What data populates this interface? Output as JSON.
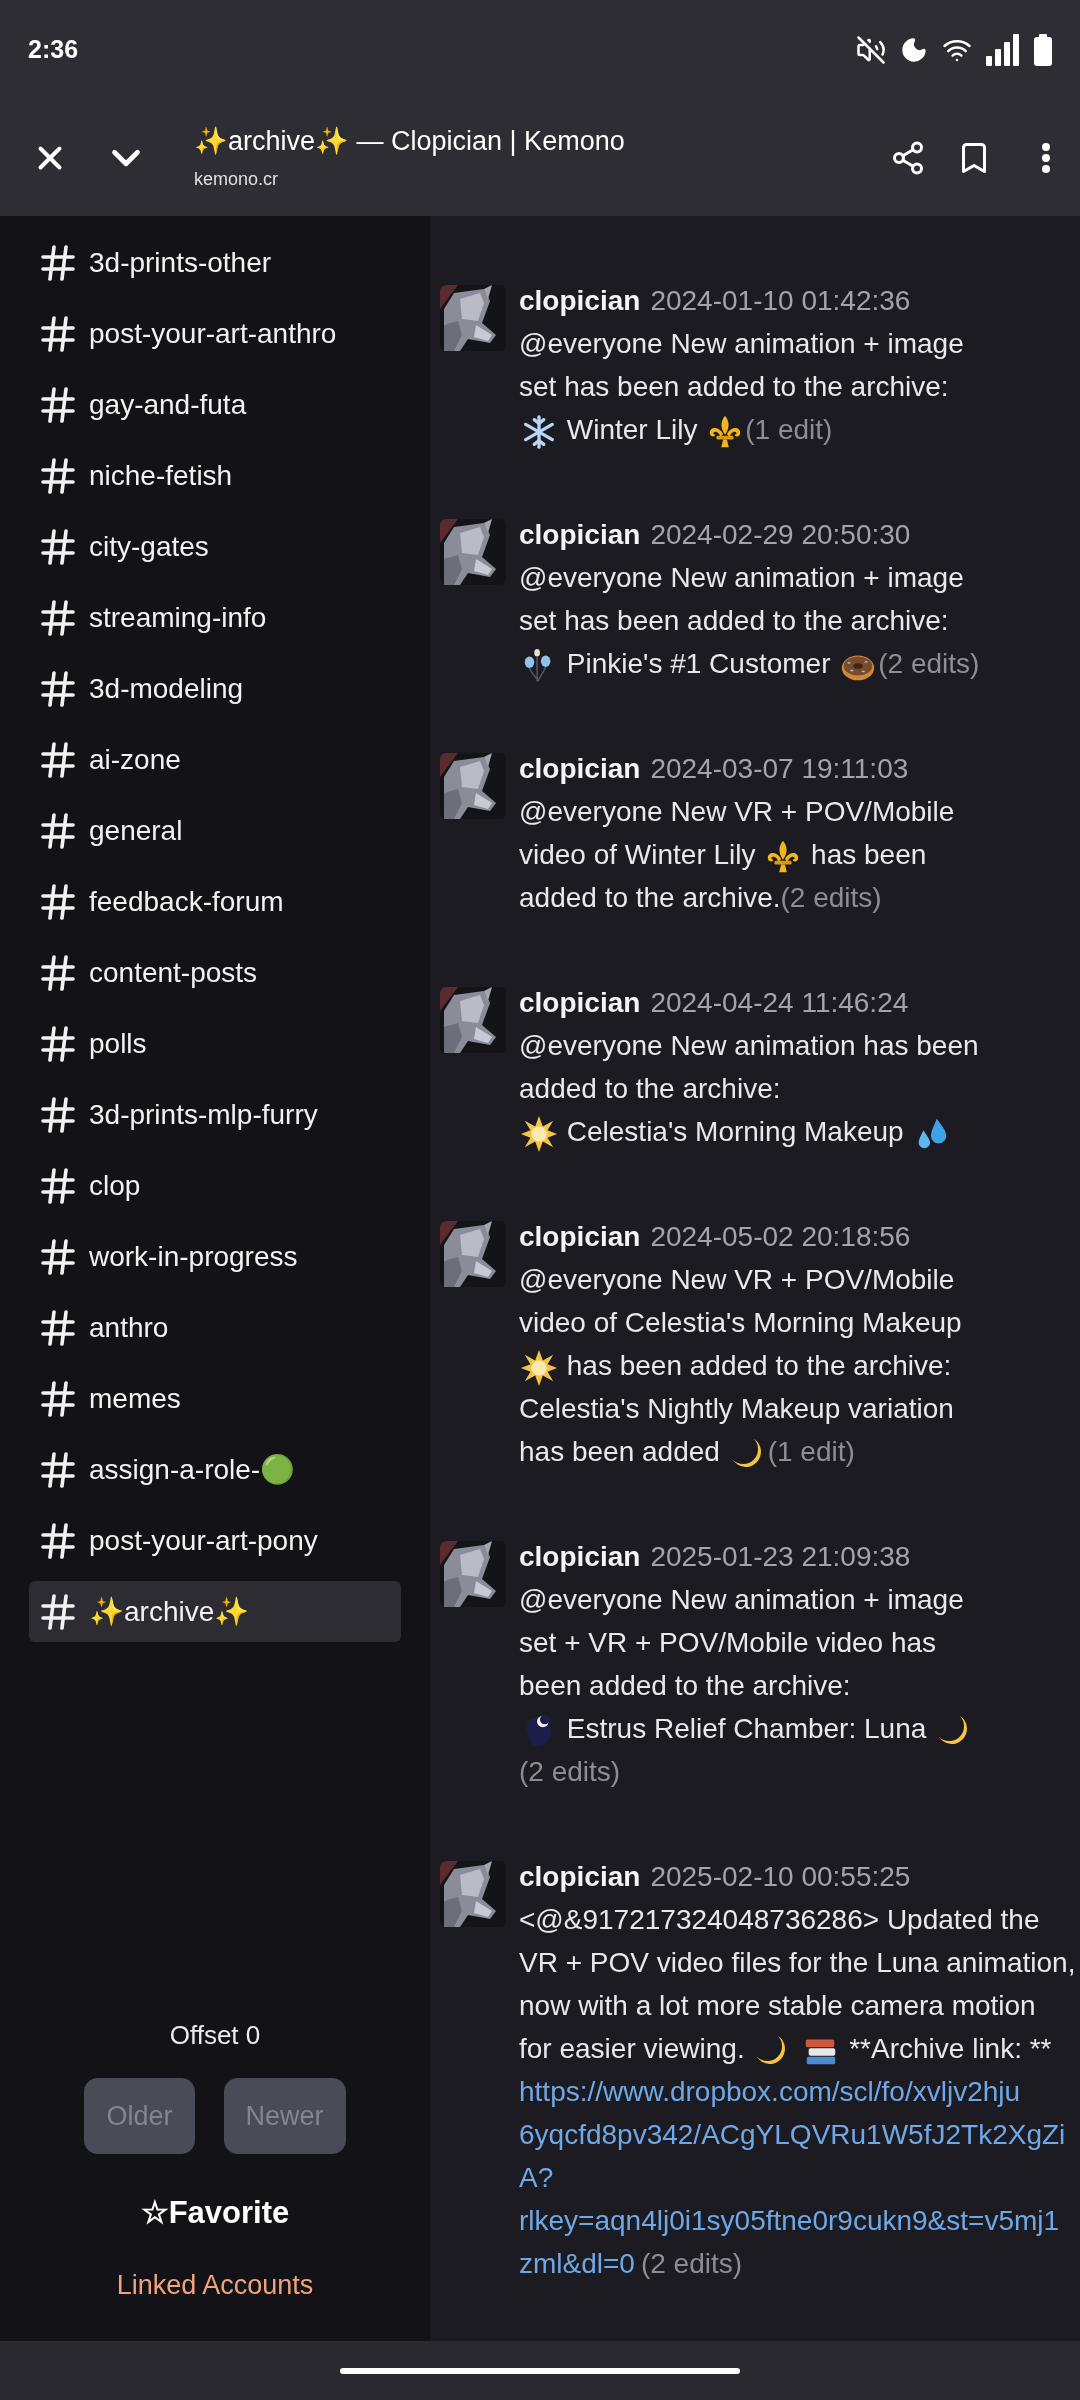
{
  "status_bar": {
    "time": "2:36"
  },
  "toolbar": {
    "title": "✨archive✨ — Clopician | Kemono",
    "url": "kemono.cr"
  },
  "sidebar": {
    "channels": [
      {
        "name": "3d-prints-other",
        "selected": false
      },
      {
        "name": "post-your-art-anthro",
        "selected": false
      },
      {
        "name": "gay-and-futa",
        "selected": false
      },
      {
        "name": "niche-fetish",
        "selected": false
      },
      {
        "name": "city-gates",
        "selected": false
      },
      {
        "name": "streaming-info",
        "selected": false
      },
      {
        "name": "3d-modeling",
        "selected": false
      },
      {
        "name": "ai-zone",
        "selected": false
      },
      {
        "name": "general",
        "selected": false
      },
      {
        "name": "feedback-forum",
        "selected": false
      },
      {
        "name": "content-posts",
        "selected": false
      },
      {
        "name": "polls",
        "selected": false
      },
      {
        "name": "3d-prints-mlp-furry",
        "selected": false
      },
      {
        "name": "clop",
        "selected": false
      },
      {
        "name": "work-in-progress",
        "selected": false
      },
      {
        "name": "anthro",
        "selected": false
      },
      {
        "name": "memes",
        "selected": false
      },
      {
        "name": "assign-a-role-🟢",
        "selected": false
      },
      {
        "name": "post-your-art-pony",
        "selected": false
      },
      {
        "name": "✨archive✨",
        "selected": true
      }
    ],
    "offset": "Offset 0",
    "buttons": [
      {
        "label": "Older",
        "disabled": true
      },
      {
        "label": "Newer",
        "disabled": true
      }
    ],
    "favorite": "☆Favorite",
    "linked_accounts": "Linked Accounts"
  },
  "messages": [
    {
      "author": "clopician",
      "time": "2024-01-10 01:42:36",
      "lines": [
        [
          {
            "kind": "text",
            "text": "@everyone New animation + image"
          }
        ],
        [
          {
            "kind": "text",
            "text": "set has been added to the archive:"
          }
        ],
        [
          {
            "kind": "snowflake"
          },
          {
            "kind": "text",
            "text": " Winter Lily "
          },
          {
            "kind": "fleur"
          },
          {
            "kind": "edits",
            "text": "(1 edit)"
          }
        ]
      ]
    },
    {
      "author": "clopician",
      "time": "2024-02-29 20:50:30",
      "lines": [
        [
          {
            "kind": "text",
            "text": "@everyone New animation + image"
          }
        ],
        [
          {
            "kind": "text",
            "text": "set has been added to the archive:"
          }
        ],
        [
          {
            "kind": "balloons"
          },
          {
            "kind": "text",
            "text": " Pinkie's #1 Customer "
          },
          {
            "kind": "donut"
          },
          {
            "kind": "edits",
            "text": "(2 edits)"
          }
        ]
      ]
    },
    {
      "author": "clopician",
      "time": "2024-03-07 19:11:03",
      "lines": [
        [
          {
            "kind": "text",
            "text": "@everyone New VR + POV/Mobile"
          }
        ],
        [
          {
            "kind": "text",
            "text": "video of Winter Lily "
          },
          {
            "kind": "fleur"
          },
          {
            "kind": "text",
            "text": " has been"
          }
        ],
        [
          {
            "kind": "text",
            "text": "added to the archive."
          },
          {
            "kind": "edits",
            "text": "(2 edits)"
          }
        ]
      ]
    },
    {
      "author": "clopician",
      "time": "2024-04-24 11:46:24",
      "lines": [
        [
          {
            "kind": "text",
            "text": "@everyone New animation has been"
          }
        ],
        [
          {
            "kind": "text",
            "text": "added to the archive:"
          }
        ],
        [
          {
            "kind": "sun"
          },
          {
            "kind": "text",
            "text": " Celestia's Morning Makeup "
          },
          {
            "kind": "droplets"
          }
        ]
      ]
    },
    {
      "author": "clopician",
      "time": "2024-05-02 20:18:56",
      "lines": [
        [
          {
            "kind": "text",
            "text": "@everyone New VR + POV/Mobile"
          }
        ],
        [
          {
            "kind": "text",
            "text": "video of Celestia's Morning Makeup"
          }
        ],
        [
          {
            "kind": "sun"
          },
          {
            "kind": "text",
            "text": " has been added to the archive:"
          }
        ],
        [
          {
            "kind": "text",
            "text": "Celestia's Nightly Makeup variation"
          }
        ],
        [
          {
            "kind": "text",
            "text": "has been added "
          },
          {
            "kind": "moon"
          },
          {
            "kind": "edits",
            "text": "(1 edit)"
          }
        ]
      ]
    },
    {
      "author": "clopician",
      "time": "2025-01-23 21:09:38",
      "lines": [
        [
          {
            "kind": "text",
            "text": "@everyone New animation + image"
          }
        ],
        [
          {
            "kind": "text",
            "text": "set + VR + POV/Mobile video has"
          }
        ],
        [
          {
            "kind": "text",
            "text": "been added to the archive:"
          }
        ],
        [
          {
            "kind": "luna"
          },
          {
            "kind": "text",
            "text": " Estrus Relief Chamber: Luna "
          },
          {
            "kind": "moon"
          }
        ],
        [
          {
            "kind": "edits",
            "text": "(2 edits)"
          }
        ]
      ]
    },
    {
      "author": "clopician",
      "time": "2025-02-10 00:55:25",
      "lines": [
        [
          {
            "kind": "text",
            "text": "<@&917217324048736286> Updated the"
          }
        ],
        [
          {
            "kind": "text",
            "text": "VR + POV video files for the Luna animation,"
          }
        ],
        [
          {
            "kind": "text",
            "text": "now with a lot more stable camera motion"
          }
        ],
        [
          {
            "kind": "text",
            "text": "for easier viewing. "
          },
          {
            "kind": "moon"
          },
          {
            "kind": "books"
          },
          {
            "kind": "text",
            "text": " **Archive link: **"
          }
        ],
        [
          {
            "kind": "link",
            "text": "https://www.dropbox.com/scl/fo/xvljv2hju"
          }
        ],
        [
          {
            "kind": "link",
            "text": "6yqcfd8pv342/ACgYLQVRu1W5fJ2Tk2XgZi"
          }
        ],
        [
          {
            "kind": "link",
            "text": "A?"
          }
        ],
        [
          {
            "kind": "link",
            "text": "rlkey=aqn4lj0i1sy05ftne0r9cukn9&st=v5mj1"
          }
        ],
        [
          {
            "kind": "link",
            "text": "zml&dl=0"
          },
          {
            "kind": "edits",
            "text": "(2 edits)"
          }
        ]
      ]
    }
  ]
}
